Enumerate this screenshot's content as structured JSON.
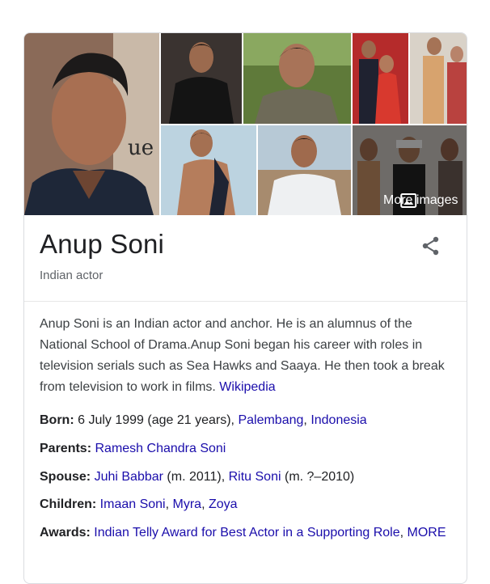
{
  "images": {
    "more_images_label": "More images"
  },
  "entity": {
    "name": "Anup Soni",
    "subtitle": "Indian actor"
  },
  "description": {
    "text": "Anup Soni is an Indian actor and anchor. He is an alumnus of the National School of Drama.Anup Soni began his career with roles in television serials such as Sea Hawks and Saaya. He then took a break from television to work in films.",
    "source": "Wikipedia"
  },
  "facts": {
    "born": {
      "label": "Born:",
      "text": "6 July 1999 (age 21 years),",
      "link1": "Palembang",
      "sep": ",",
      "link2": "Indonesia"
    },
    "parents": {
      "label": "Parents:",
      "link1": "Ramesh Chandra Soni"
    },
    "spouse": {
      "label": "Spouse:",
      "link1": "Juhi Babbar",
      "text1": "(m. 2011),",
      "link2": "Ritu Soni",
      "text2": "(m. ?–2010)"
    },
    "children": {
      "label": "Children:",
      "link1": "Imaan Soni",
      "sep1": ",",
      "link2": "Myra",
      "sep2": ",",
      "link3": "Zoya"
    },
    "awards": {
      "label": "Awards:",
      "link1": "Indian Telly Award for Best Actor in a Supporting Role",
      "sep": ",",
      "more": "MORE"
    }
  },
  "colors": {
    "link": "#1a0dab",
    "text": "#202124",
    "muted": "#5f6368",
    "border": "#dadce0"
  }
}
